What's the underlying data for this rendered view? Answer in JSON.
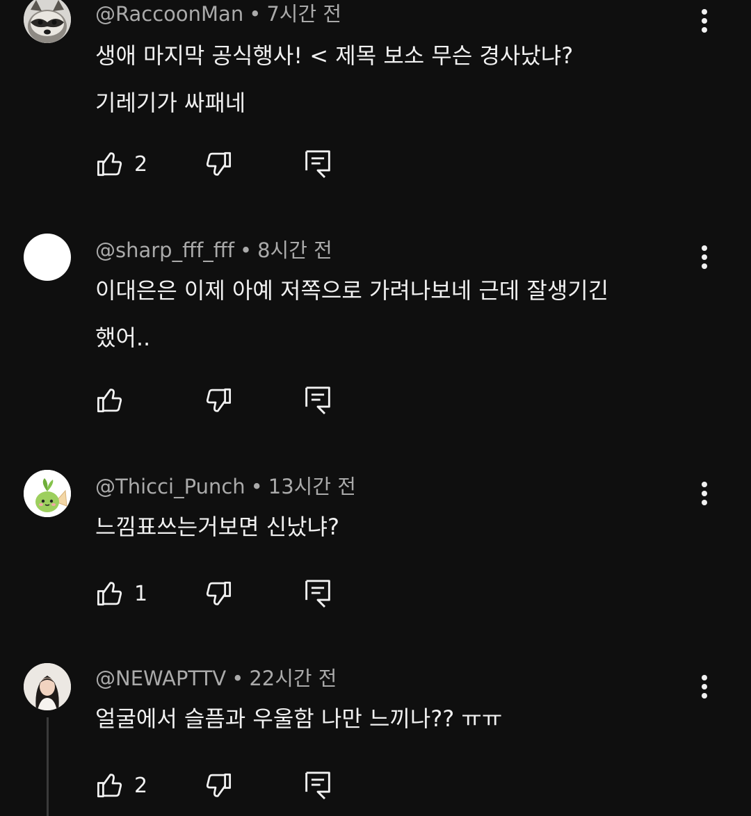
{
  "comments": [
    {
      "username": "@RaccoonMan",
      "time": "7시간 전",
      "lines": [
        "생애 마지막 공식행사! < 제목 보소 무슨 경사났냐?",
        "기레기가 싸패네"
      ],
      "likes": "2"
    },
    {
      "username": "@sharp_fff_fff",
      "time": "8시간 전",
      "lines": [
        "이대은은 이제 아예 저쪽으로 가려나보네 근데 잘생기긴",
        "했어.."
      ],
      "likes": ""
    },
    {
      "username": "@Thicci_Punch",
      "time": "13시간 전",
      "lines": [
        "느낌표쓰는거보면 신났냐?",
        ""
      ],
      "likes": "1"
    },
    {
      "username": "@NEWAPTTV",
      "time": "22시간 전",
      "lines": [
        "얼굴에서 슬픔과 우울함 나만 느끼나?? ㅠㅠ",
        ""
      ],
      "likes": "2"
    }
  ],
  "separator": "•",
  "icons": {
    "like": "thumbs-up-icon",
    "dislike": "thumbs-down-icon",
    "reply": "reply-comment-icon",
    "menu": "more-vert-icon"
  },
  "colors": {
    "background": "#0f0f0f",
    "text": "#f1f1f1",
    "meta": "#aaaaaa"
  }
}
